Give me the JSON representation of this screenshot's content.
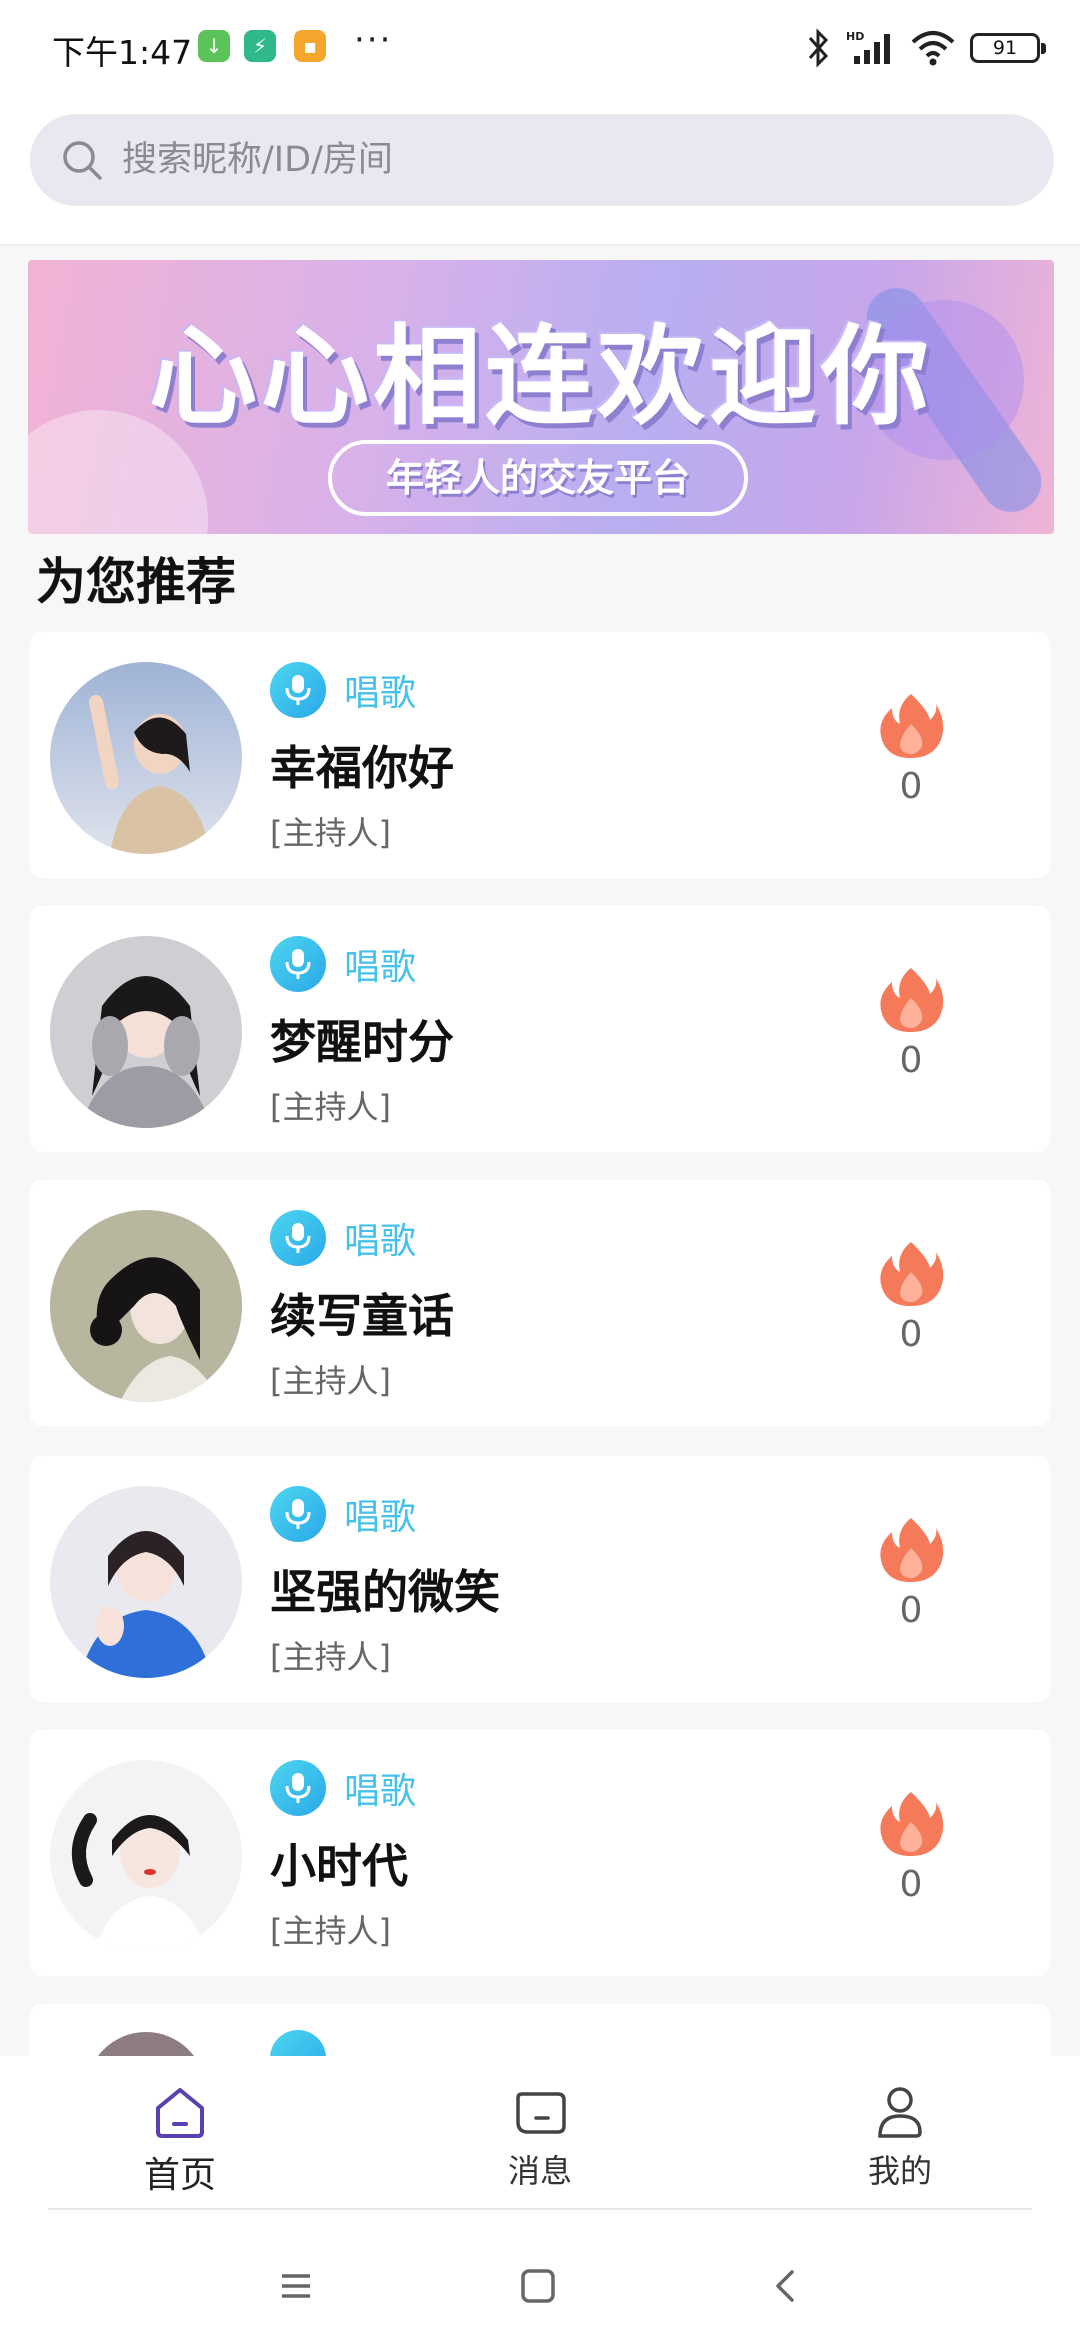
{
  "status_bar": {
    "time": "下午1:47",
    "battery": "91"
  },
  "search": {
    "placeholder": "搜索昵称/ID/房间"
  },
  "banner": {
    "title": "心心相连欢迎你",
    "subtitle": "年轻人的交友平台"
  },
  "section": {
    "title": "为您推荐"
  },
  "rooms": [
    {
      "category": "唱歌",
      "name": "幸福你好",
      "role": "[主持人]",
      "heat": "0"
    },
    {
      "category": "唱歌",
      "name": "梦醒时分",
      "role": "[主持人]",
      "heat": "0"
    },
    {
      "category": "唱歌",
      "name": "续写童话",
      "role": "[主持人]",
      "heat": "0"
    },
    {
      "category": "唱歌",
      "name": "坚强的微笑",
      "role": "[主持人]",
      "heat": "0"
    },
    {
      "category": "唱歌",
      "name": "小时代",
      "role": "[主持人]",
      "heat": "0"
    }
  ],
  "nav": {
    "home": "首页",
    "messages": "消息",
    "mine": "我的"
  },
  "colors": {
    "accent_purple": "#5a3fb0",
    "tag_blue": "#45c1ea",
    "heat_orange": "#f47a5a"
  }
}
